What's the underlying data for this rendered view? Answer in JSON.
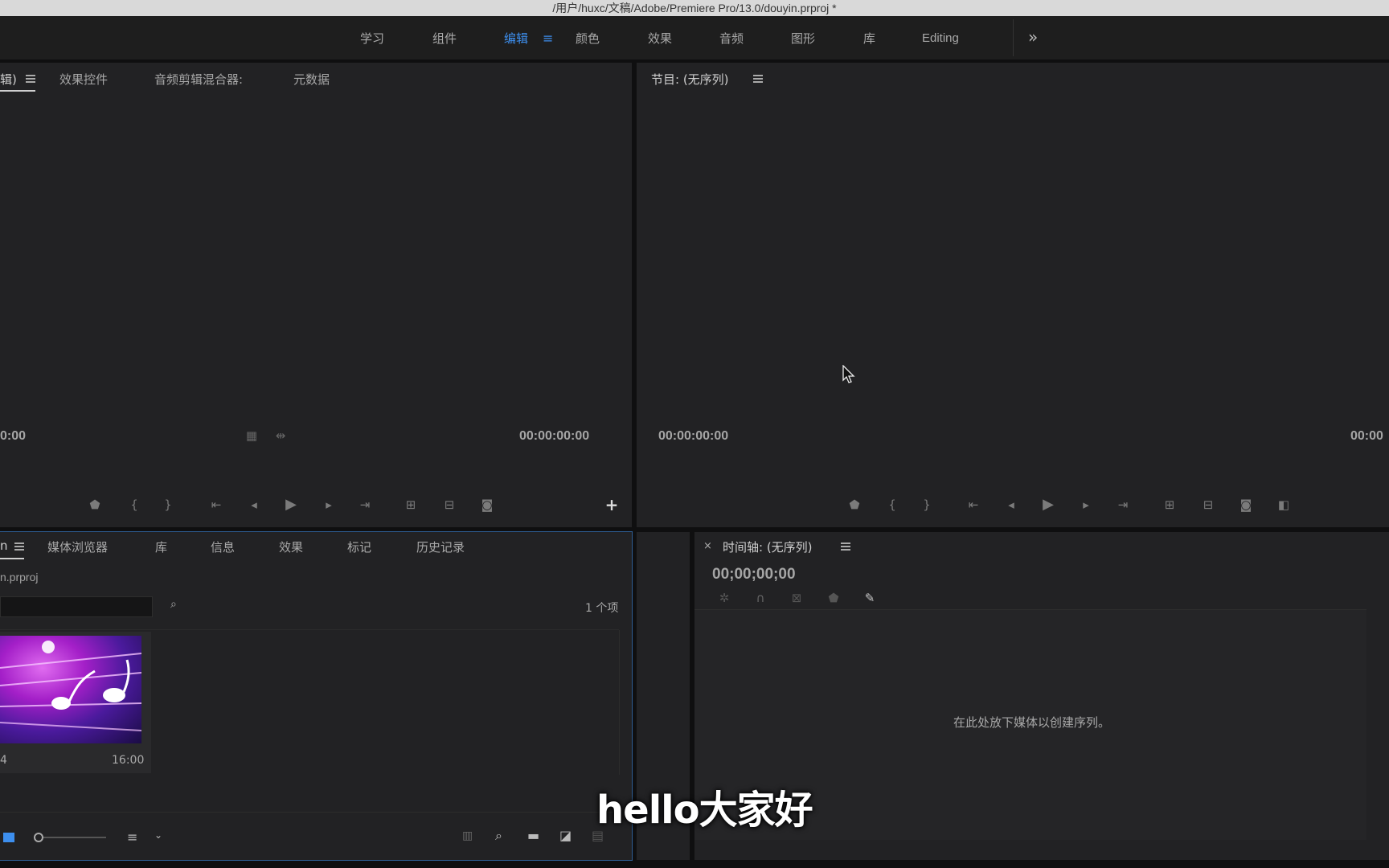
{
  "window": {
    "title": "/用户/huxc/文稿/Adobe/Premiere Pro/13.0/douyin.prproj *"
  },
  "workspaces": {
    "tabs": [
      {
        "label": "学习"
      },
      {
        "label": "组件"
      },
      {
        "label": "编辑"
      },
      {
        "label": "颜色"
      },
      {
        "label": "效果"
      },
      {
        "label": "音频"
      },
      {
        "label": "图形"
      },
      {
        "label": "库"
      },
      {
        "label": "Editing"
      }
    ],
    "active": "编辑"
  },
  "source_panel": {
    "tabs": [
      "辑)",
      "效果控件",
      "音频剪辑混合器:",
      "元数据"
    ],
    "timecode_left": "0:00",
    "timecode_right": "00:00:00:00"
  },
  "program_panel": {
    "title": "节目: (无序列)",
    "timecode_left": "00:00:00:00",
    "timecode_right": "00:00"
  },
  "project_panel": {
    "tabs": [
      "n",
      "媒体浏览器",
      "库",
      "信息",
      "效果",
      "标记",
      "历史记录"
    ],
    "file_name": "n.prproj",
    "item_count": "1 个项",
    "clip": {
      "name": "4",
      "duration": "16:00"
    }
  },
  "timeline_panel": {
    "title": "时间轴: (无序列)",
    "timecode": "00;00;00;00",
    "empty_message": "在此处放下媒体以创建序列。"
  },
  "subtitle": "hello大家好",
  "colors": {
    "accent": "#3d8fef",
    "panel_bg": "#222224",
    "app_bg": "#0f0f10"
  }
}
